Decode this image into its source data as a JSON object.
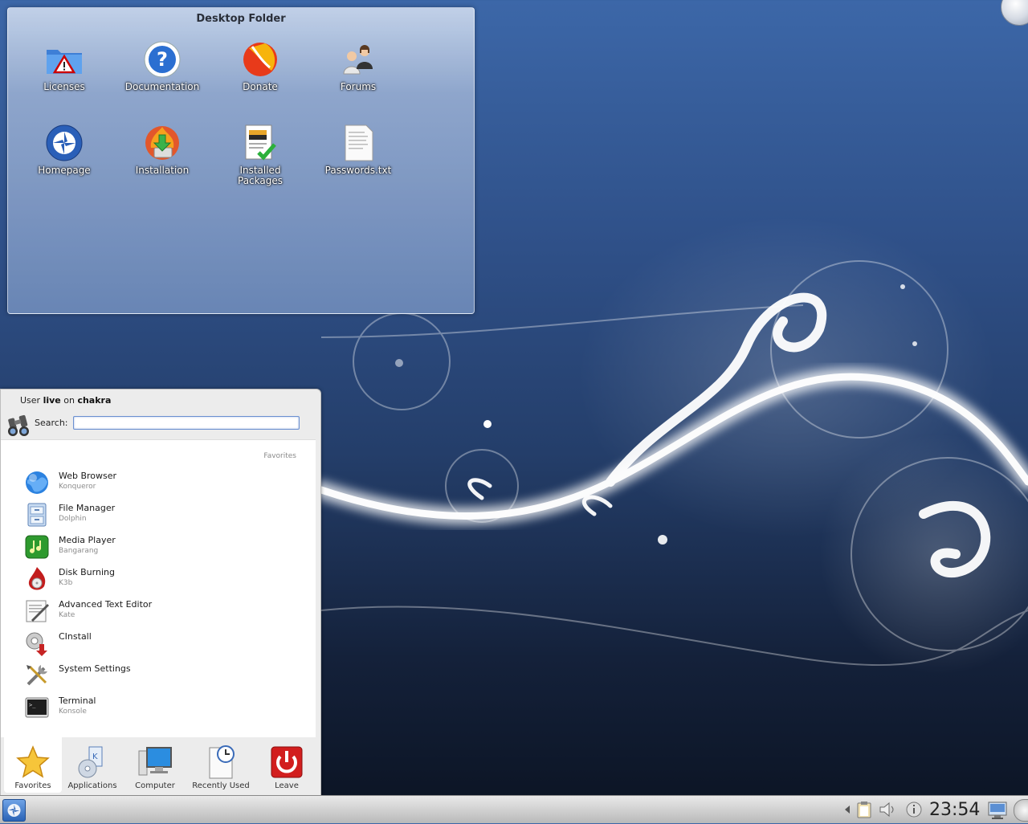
{
  "desktop_folder": {
    "title": "Desktop Folder",
    "icons": [
      {
        "label": "Licenses",
        "icon": "folder-warning-icon"
      },
      {
        "label": "Documentation",
        "icon": "help-icon"
      },
      {
        "label": "Donate",
        "icon": "donate-ball-icon"
      },
      {
        "label": "Forums",
        "icon": "users-icon"
      },
      {
        "label": "Homepage",
        "icon": "chakra-logo-icon"
      },
      {
        "label": "Installation",
        "icon": "installer-icon"
      },
      {
        "label": "Installed Packages",
        "icon": "packages-icon"
      },
      {
        "label": "Passwords.txt",
        "icon": "text-file-icon"
      }
    ]
  },
  "kickoff": {
    "user_prefix": "User ",
    "user_name": "live",
    "user_mid": " on ",
    "host_name": "chakra",
    "search_label": "Search:",
    "search_value": "",
    "section_header": "Favorites",
    "favorites": [
      {
        "name": "Web Browser",
        "sub": "Konqueror",
        "icon": "globe-icon"
      },
      {
        "name": "File Manager",
        "sub": "Dolphin",
        "icon": "file-cabinet-icon"
      },
      {
        "name": "Media Player",
        "sub": "Bangarang",
        "icon": "media-player-icon"
      },
      {
        "name": "Disk Burning",
        "sub": "K3b",
        "icon": "disk-burning-icon"
      },
      {
        "name": "Advanced Text Editor",
        "sub": "Kate",
        "icon": "text-editor-icon"
      },
      {
        "name": "CInstall",
        "sub": "",
        "icon": "cinstall-icon"
      },
      {
        "name": "System Settings",
        "sub": "",
        "icon": "settings-tools-icon"
      },
      {
        "name": "Terminal",
        "sub": "Konsole",
        "icon": "terminal-icon"
      }
    ],
    "tabs": [
      {
        "label": "Favorites",
        "icon": "star-icon"
      },
      {
        "label": "Applications",
        "icon": "applications-icon"
      },
      {
        "label": "Computer",
        "icon": "computer-icon"
      },
      {
        "label": "Recently Used",
        "icon": "recent-document-icon"
      },
      {
        "label": "Leave",
        "icon": "power-icon"
      }
    ]
  },
  "panel": {
    "clock": "23:54"
  }
}
